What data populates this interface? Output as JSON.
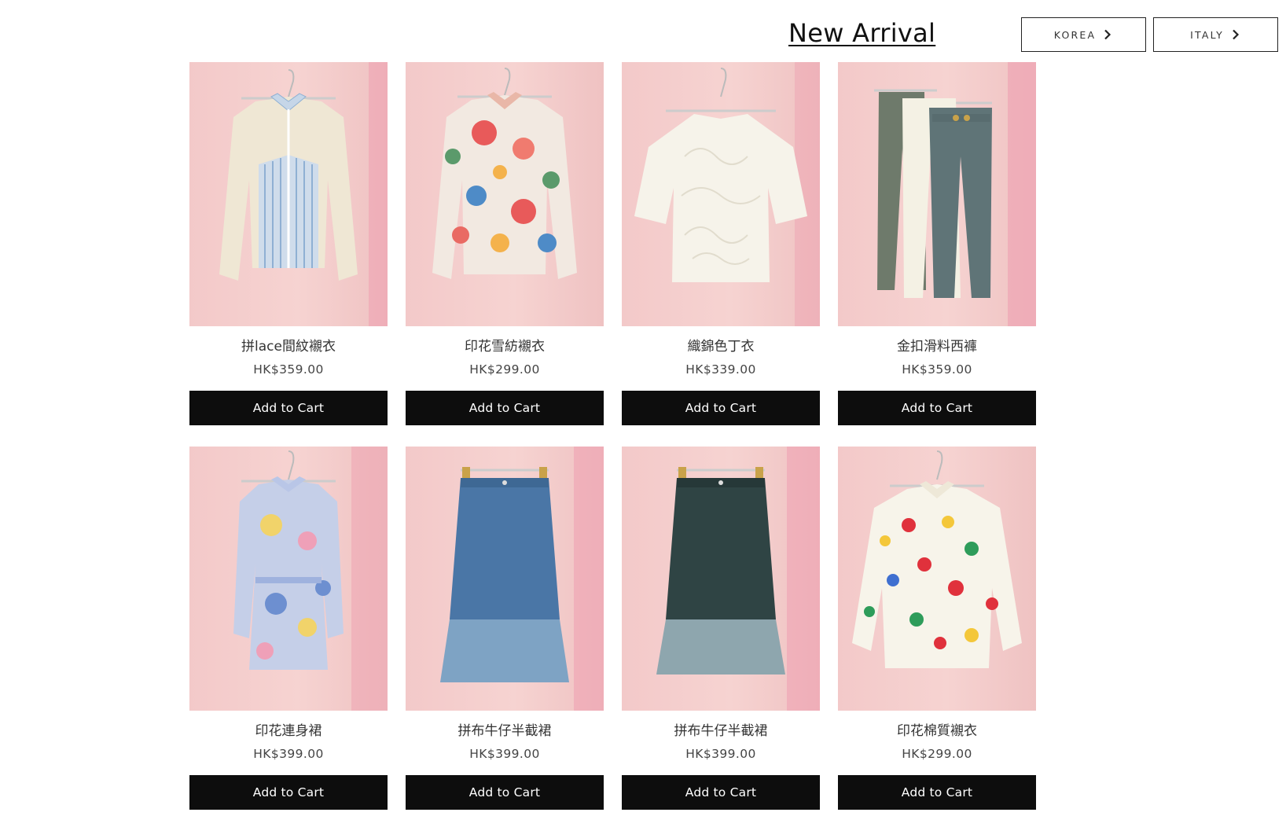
{
  "header": {
    "title": "New Arrival",
    "buttons": [
      {
        "label": "KOREA",
        "icon": "chevron-right-icon"
      },
      {
        "label": "ITALY",
        "icon": "chevron-right-icon"
      }
    ]
  },
  "colors": {
    "accent": "#0d0d0d",
    "background": "#ffffff",
    "wall": "#f4cccc"
  },
  "products": [
    {
      "name": "拼lace間紋襯衣",
      "price": "HK$359.00",
      "cart_label": "Add to Cart",
      "image": "lace-striped-blouse"
    },
    {
      "name": "印花雪紡襯衣",
      "price": "HK$299.00",
      "cart_label": "Add to Cart",
      "image": "floral-chiffon-shirt"
    },
    {
      "name": "織錦色丁衣",
      "price": "HK$339.00",
      "cart_label": "Add to Cart",
      "image": "white-jacquard-top"
    },
    {
      "name": "金扣滑料西褲",
      "price": "HK$359.00",
      "cart_label": "Add to Cart",
      "image": "three-trousers"
    },
    {
      "name": "印花連身裙",
      "price": "HK$399.00",
      "cart_label": "Add to Cart",
      "image": "printed-dress"
    },
    {
      "name": "拼布牛仔半截裙",
      "price": "HK$399.00",
      "cart_label": "Add to Cart",
      "image": "blue-denim-skirt"
    },
    {
      "name": "拼布牛仔半截裙",
      "price": "HK$399.00",
      "cart_label": "Add to Cart",
      "image": "dark-denim-skirt"
    },
    {
      "name": "印花棉質襯衣",
      "price": "HK$299.00",
      "cart_label": "Add to Cart",
      "image": "floral-cotton-shirt"
    }
  ]
}
